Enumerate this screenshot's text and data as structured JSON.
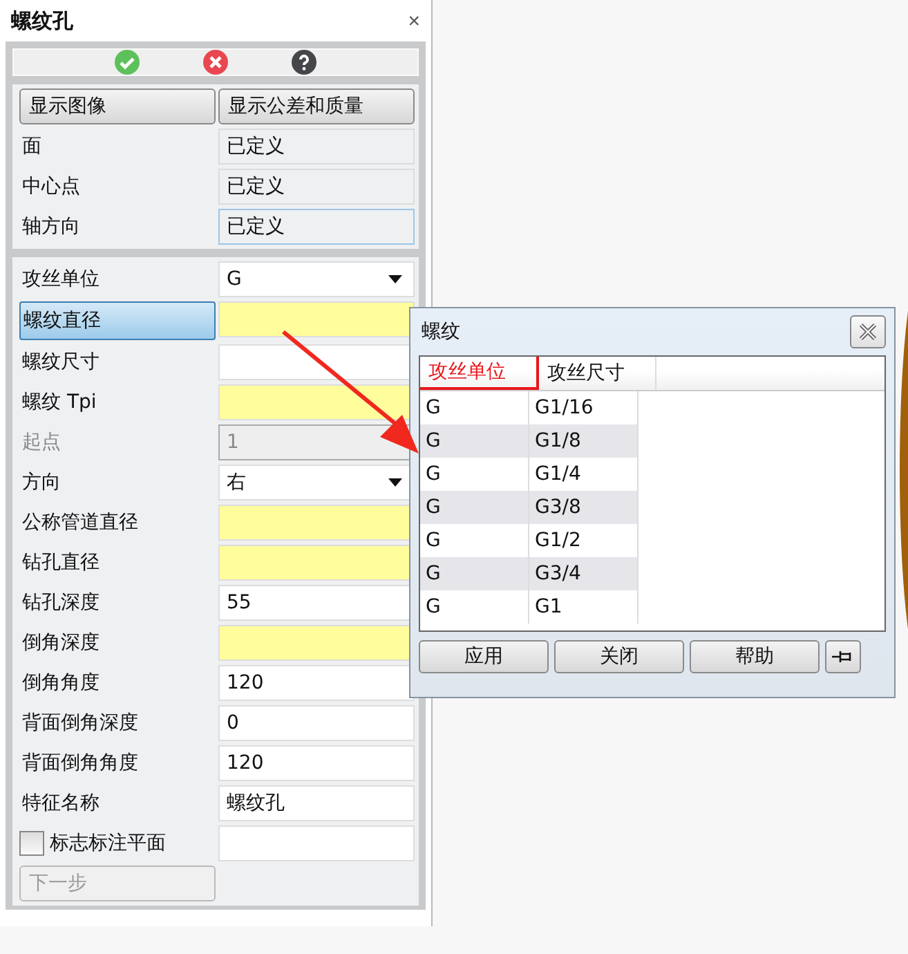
{
  "panel": {
    "title": "螺纹孔",
    "close": "×"
  },
  "view_buttons": [
    "显示图像",
    "显示公差和质量"
  ],
  "defined_rows": [
    {
      "label": "面",
      "value": "已定义",
      "focused": false
    },
    {
      "label": "中心点",
      "value": "已定义",
      "focused": false
    },
    {
      "label": "轴方向",
      "value": "已定义",
      "focused": true
    }
  ],
  "params": [
    {
      "label": "攻丝单位",
      "kind": "dropdown",
      "value": "G",
      "selected": false,
      "required": false,
      "disabled": false
    },
    {
      "label": "螺纹直径",
      "kind": "text",
      "selected": true,
      "required": true,
      "disabled": false
    },
    {
      "label": "螺纹尺寸",
      "kind": "text",
      "selected": false,
      "required": false,
      "disabled": false
    },
    {
      "label": "螺纹 Tpi",
      "kind": "text",
      "selected": false,
      "required": true,
      "disabled": false
    },
    {
      "label": "起点",
      "kind": "text",
      "value": "1",
      "selected": false,
      "required": false,
      "disabled": true
    },
    {
      "label": "方向",
      "kind": "dropdown",
      "value": "右",
      "selected": false,
      "required": false,
      "disabled": false
    },
    {
      "label": "公称管道直径",
      "kind": "text",
      "selected": false,
      "required": true,
      "disabled": false
    },
    {
      "label": "钻孔直径",
      "kind": "text",
      "selected": false,
      "required": true,
      "disabled": false
    },
    {
      "label": "钻孔深度",
      "kind": "text",
      "value": "55",
      "selected": false,
      "required": false,
      "disabled": false
    },
    {
      "label": "倒角深度",
      "kind": "text",
      "selected": false,
      "required": true,
      "disabled": false
    },
    {
      "label": "倒角角度",
      "kind": "text",
      "value": "120",
      "selected": false,
      "required": false,
      "disabled": false
    },
    {
      "label": "背面倒角深度",
      "kind": "text",
      "value": "0",
      "selected": false,
      "required": false,
      "disabled": false
    },
    {
      "label": "背面倒角角度",
      "kind": "text",
      "value": "120",
      "selected": false,
      "required": false,
      "disabled": false
    },
    {
      "label": "特征名称",
      "kind": "text",
      "value": "螺纹孔",
      "selected": false,
      "required": false,
      "disabled": false
    },
    {
      "label": "标志标注平面",
      "kind": "checkbox",
      "checked": false,
      "selected": false,
      "disabled": false
    }
  ],
  "next_button": {
    "label": "下一步",
    "disabled": true
  },
  "dialog": {
    "title": "螺纹",
    "columns": [
      {
        "label": "攻丝单位",
        "selected": true
      },
      {
        "label": "攻丝尺寸",
        "selected": false
      }
    ],
    "rows": [
      [
        "G",
        "G1/16"
      ],
      [
        "G",
        "G1/8"
      ],
      [
        "G",
        "G1/4"
      ],
      [
        "G",
        "G3/8"
      ],
      [
        "G",
        "G1/2"
      ],
      [
        "G",
        "G3/4"
      ],
      [
        "G",
        "G1"
      ]
    ],
    "buttons": [
      "应用",
      "关闭",
      "帮助"
    ]
  }
}
